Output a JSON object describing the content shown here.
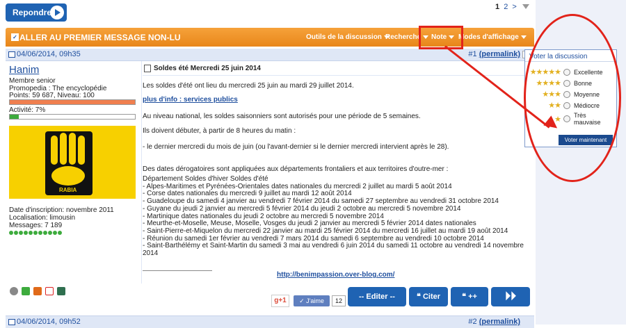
{
  "toolbar": {
    "reply_label": "Repondre"
  },
  "pagination": {
    "current": "1",
    "next": "2",
    "more": ">"
  },
  "thread_bar": {
    "first_unread": "ALLER AU PREMIER MESSAGE NON-LU",
    "tools": [
      {
        "label": "Outils de la discussion"
      },
      {
        "label": "Recherche"
      },
      {
        "label": "Note"
      },
      {
        "label": "Modes d'affichage"
      }
    ]
  },
  "vote_panel": {
    "title": "Voter la discussion",
    "options": [
      {
        "label": "Excellente",
        "stars": "★★★★★"
      },
      {
        "label": "Bonne",
        "stars": "★★★★"
      },
      {
        "label": "Moyenne",
        "stars": "★★★"
      },
      {
        "label": "Médiocre",
        "stars": "★★"
      },
      {
        "label": "Très mauvaise",
        "stars": "★"
      }
    ],
    "submit": "Voter maintenant"
  },
  "post1": {
    "date": "04/06/2014, 09h35",
    "num": "#1",
    "permalink": "(permalink)",
    "user": {
      "name": "Hanim",
      "rank": "Membre senior",
      "promo": "Promopedia : The encyclopédie",
      "points": "Points: 59 687, Niveau: 100",
      "activity": "Activité: 7%",
      "activity_value": 7,
      "joined": "Date d'inscription: novembre 2011",
      "location": "Localisation: limousin",
      "messages": "Messages: 7 189",
      "avatar_text": "RABIA"
    },
    "title": "Soldes été Mercredi 25 juin 2014",
    "lines": {
      "l1": "Les soldes d'été ont lieu du mercredi 25 juin au mardi 29 juillet 2014.",
      "link": "plus d'info : services publics",
      "l2": "Au niveau national, les soldes saisonniers sont autorisés pour une période de 5 semaines.",
      "l3": "Ils doivent débuter, à partir de 8 heures du matin :",
      "l4": "- le dernier mercredi du mois de juin (ou l'avant-dernier si le dernier mercredi intervient après le 28).",
      "l5": "Des dates dérogatoires sont appliquées aux départements frontaliers et aux territoires d'outre-mer :"
    },
    "list": [
      "Département Soldes d'hiver Soldes d'été",
      "- Alpes-Maritimes et Pyrénées-Orientales dates nationales du mercredi 2 juillet au mardi 5 août 2014",
      "- Corse dates nationales du mercredi 9 juillet au mardi 12 août 2014",
      "- Guadeloupe du samedi 4 janvier au vendredi 7 février 2014 du samedi 27 septembre au vendredi 31 octobre 2014",
      "- Guyane du jeudi 2 janvier au mercredi 5 février 2014 du jeudi 2 octobre au mercredi 5 novembre 2014",
      "- Martinique dates nationales du jeudi 2 octobre au mercredi 5 novembre 2014",
      "- Meurthe-et-Moselle, Meuse, Moselle, Vosges du jeudi 2 janvier au mercredi 5 février 2014 dates nationales",
      "- Saint-Pierre-et-Miquelon du mercredi 22 janvier au mardi 25 février 2014 du mercredi 16 juillet au mardi 19 août 2014",
      "- Réunion du samedi 1er février au vendredi 7 mars 2014 du samedi 6 septembre au vendredi 10 octobre 2014",
      "- Saint-Barthélémy et Saint-Martin du samedi 3 mai au vendredi 6 juin 2014 du samedi 11 octobre au vendredi 14 novembre",
      "2014"
    ],
    "blog_link": "http://benimpassion.over-blog.com/",
    "actions": {
      "gplus": "g+1",
      "like": "J'aime",
      "like_count": "12",
      "edit": "-- Editer --",
      "quote": "Citer",
      "multi_quote": "++"
    }
  },
  "post2": {
    "date": "04/06/2014, 09h52",
    "num": "#2",
    "permalink": "(permalink)"
  }
}
